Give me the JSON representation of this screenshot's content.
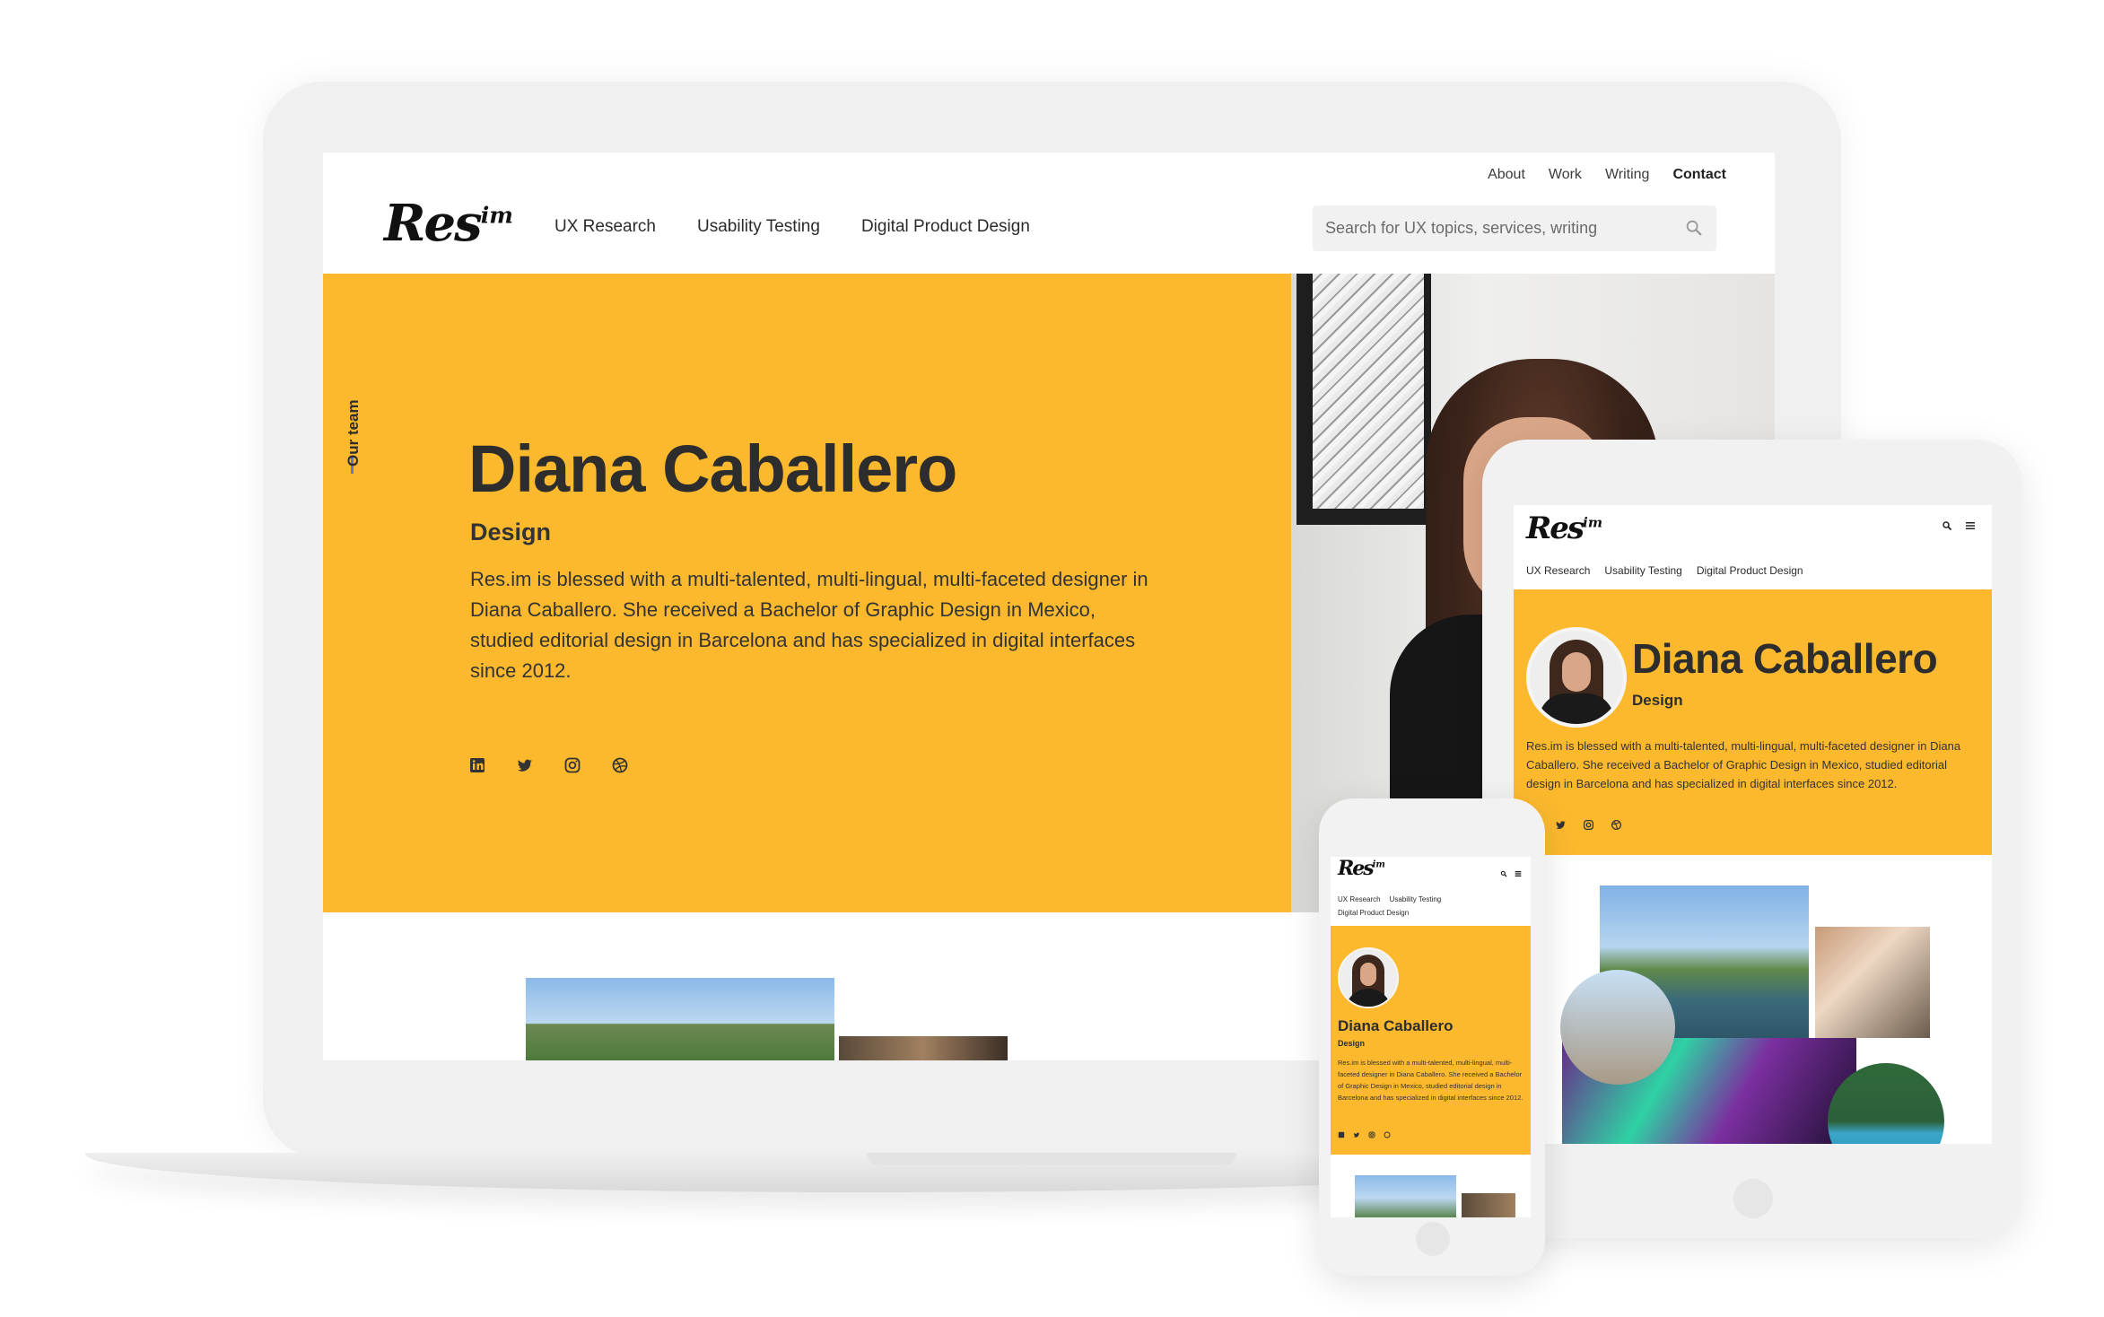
{
  "brand": {
    "logo": "Res",
    "logo_sup": "im"
  },
  "utility_nav": [
    "About",
    "Work",
    "Writing",
    "Contact"
  ],
  "utility_nav_active": "Contact",
  "main_nav": [
    "UX Research",
    "Usability Testing",
    "Digital Product Design"
  ],
  "search": {
    "placeholder": "Search for UX topics, services, writing",
    "icon": "search-icon"
  },
  "section_label": "Our team",
  "profile": {
    "name": "Diana Caballero",
    "role": "Design",
    "bio": "Res.im is blessed with a multi-talented, multi-lingual, multi-faceted designer in Diana Caballero. She received a Bachelor of Graphic Design in Mexico, studied editorial design in Barcelona and has specialized in digital interfaces since 2012.",
    "socials": [
      "linkedin-icon",
      "twitter-icon",
      "instagram-icon",
      "dribbble-icon"
    ]
  },
  "colors": {
    "accent": "#fcb92e",
    "text": "#2d2d2d",
    "device": "#f0f0f0",
    "rule": "#5b7cc9"
  },
  "mobile_icons": [
    "search-icon",
    "menu-icon"
  ]
}
